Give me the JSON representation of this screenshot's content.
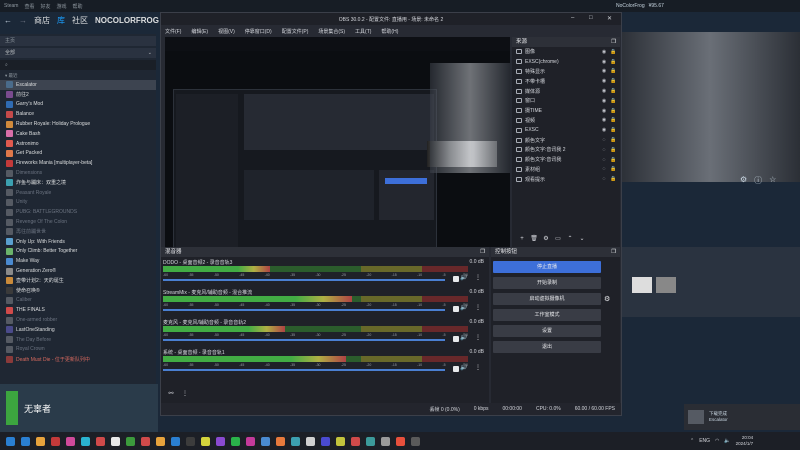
{
  "steam": {
    "title": "Steam",
    "menus": [
      "Steam",
      "查看",
      "好友",
      "游戏",
      "帮助"
    ],
    "nav": {
      "store": "商店",
      "library": "库",
      "community": "社区",
      "user": "NOCOLORFROG"
    },
    "user_bar": {
      "name": "NoColorFrog",
      "balance": "¥95.67"
    },
    "library": {
      "home": "主页",
      "filter": "全部",
      "section": "最近",
      "games": [
        {
          "name": "Escalator",
          "selected": true,
          "style": "normal",
          "color": "#4a6b8a"
        },
        {
          "name": "前往2",
          "style": "normal",
          "color": "#7a4b8f"
        },
        {
          "name": "Garry's Mod",
          "style": "normal",
          "color": "#2f6bb3"
        },
        {
          "name": "Balance",
          "style": "normal",
          "color": "#c44a4a"
        },
        {
          "name": "Rubber Royale: Holiday Prologue",
          "style": "normal",
          "color": "#d08a3c"
        },
        {
          "name": "Cake Bash",
          "style": "normal",
          "color": "#d86ea8"
        },
        {
          "name": "Astronimo",
          "style": "normal",
          "color": "#e05a4f"
        },
        {
          "name": "Get Packed",
          "style": "normal",
          "color": "#e0784a"
        },
        {
          "name": "Fireworks Mania [multiplayer-beta]",
          "style": "normal",
          "color": "#c33a3a"
        },
        {
          "name": "Dimensions",
          "style": "dim",
          "color": "#555a63"
        },
        {
          "name": "炸鱼与蹦床：双重之境",
          "style": "normal",
          "color": "#3ca0b0"
        },
        {
          "name": "Peasant Royale",
          "style": "dim",
          "color": "#555a63"
        },
        {
          "name": "Unity",
          "style": "dim",
          "color": "#555a63"
        },
        {
          "name": "PUBG: BATTLEGROUNDS",
          "style": "dim",
          "color": "#555a63"
        },
        {
          "name": "Revenge Of The Colon",
          "style": "dim",
          "color": "#555a63"
        },
        {
          "name": "再往前蹦世世",
          "style": "dim",
          "color": "#555a63"
        },
        {
          "name": "Only Up: With Friends",
          "style": "normal",
          "color": "#5aa0d0"
        },
        {
          "name": "Only Climb: Better Together",
          "style": "normal",
          "color": "#6bb36b"
        },
        {
          "name": "Make Way",
          "style": "normal",
          "color": "#4a8ad0"
        },
        {
          "name": "Generation Zero®",
          "style": "normal",
          "color": "#8a8a8a"
        },
        {
          "name": "壶带计划2：天的诞生",
          "style": "normal",
          "color": "#c98a3a"
        },
        {
          "name": "使命召唤®",
          "style": "normal",
          "color": "#3a3a3a"
        },
        {
          "name": "Caliber",
          "style": "dim",
          "color": "#555a63"
        },
        {
          "name": "THE FINALS",
          "style": "normal",
          "color": "#d04a4a"
        },
        {
          "name": "One-armed robber",
          "style": "dim",
          "color": "#555a63"
        },
        {
          "name": "LastOneStanding",
          "style": "normal",
          "color": "#4a4a8a"
        },
        {
          "name": "The Day Before",
          "style": "dim",
          "color": "#555a63"
        },
        {
          "name": "Royal Crown",
          "style": "dim",
          "color": "#555a63"
        },
        {
          "name": "Death Must Die - 位于更新队列中",
          "style": "red",
          "color": "#8a3a3a"
        }
      ]
    },
    "friends": {
      "name": "无辜者"
    }
  },
  "obs": {
    "title": "OBS 30.0.2 - 配置文件: 直播用 - 场景: 未命名 2",
    "menus": [
      "文件(F)",
      "编辑(E)",
      "视图(V)",
      "停靠窗口(D)",
      "配置文件(P)",
      "场景集合(S)",
      "工具(T)",
      "帮助(H)"
    ],
    "sources": {
      "header": "来源",
      "items": [
        {
          "name": "图像",
          "visible": true,
          "locked": true
        },
        {
          "name": "EXSC(chrome)",
          "visible": true,
          "locked": true
        },
        {
          "name": "特殊显示",
          "visible": true,
          "locked": true
        },
        {
          "name": "不带卡槽",
          "visible": true,
          "locked": true
        },
        {
          "name": "媒体源",
          "visible": true,
          "locked": true
        },
        {
          "name": "窗口",
          "visible": true,
          "locked": true
        },
        {
          "name": "摄TIME",
          "visible": true,
          "locked": true
        },
        {
          "name": "视频",
          "visible": true,
          "locked": true
        },
        {
          "name": "EXSC",
          "visible": true,
          "locked": true
        },
        {
          "name": "颜色文字",
          "visible": false,
          "locked": true
        },
        {
          "name": "颜色文字:音讯我 2",
          "visible": false,
          "locked": true
        },
        {
          "name": "颜色文字:音讯我",
          "visible": false,
          "locked": true
        },
        {
          "name": "素材组",
          "visible": false,
          "locked": true
        },
        {
          "name": "观看提示",
          "visible": false,
          "locked": true
        }
      ]
    },
    "mixer": {
      "header": "混音器",
      "ticks": [
        "-60",
        "-55",
        "-50",
        "-45",
        "-40",
        "-35",
        "-30",
        "-25",
        "-20",
        "-15",
        "-10",
        "-5",
        "0"
      ],
      "tracks": [
        {
          "label": "DODO - 桌面音频2 - 录音音轨3",
          "db": "0.0 dB",
          "level": 0.35
        },
        {
          "label": "StreamMix - 麦克风/辅助音频 - 混合推流",
          "db": "0.0 dB",
          "level": 0.62
        },
        {
          "label": "麦克风 - 麦克风/辅助音频 - 录音音轨2",
          "db": "0.0 dB",
          "level": 0.4
        },
        {
          "label": "系统 - 桌面音频 - 录音音轨1",
          "db": "0.0 dB",
          "level": 0.6
        }
      ]
    },
    "controls": {
      "header": "控制按钮",
      "stop_stream": "停止直播",
      "start_record": "开始录制",
      "virtual_cam": "启动虚拟摄像机",
      "studio_mode": "工作室模式",
      "settings": "设置",
      "exit": "退出"
    },
    "status": {
      "frames": "丢帧 0 (0.0%)",
      "net": "0 kbps",
      "time": "00:00:00",
      "cpu": "CPU: 0.0%",
      "fps": "60.00 / 60.00 FPS"
    }
  },
  "notification": {
    "title": "下载完成",
    "game": "Escalator"
  },
  "taskbar": {
    "icons": [
      "#2a7fd1",
      "#e8a33c",
      "#c43a3a",
      "#d04a9a",
      "#2ab3d0",
      "#d04a4a",
      "#e8e8e8",
      "#3c9a3c",
      "#d04a4a",
      "#e8a33c",
      "#2a7fd1",
      "#3c3c3c",
      "#d4d43c",
      "#8a4ad0",
      "#2ab34a",
      "#c43a9a",
      "#4a8ad0",
      "#e87a3c",
      "#3ca0b0",
      "#d0d0d0",
      "#4a4ad0",
      "#c4c43c",
      "#d04a4a",
      "#3c9a9a",
      "#9a9a9a",
      "#e8503c",
      "#5a5a5a"
    ],
    "lang": "ENG",
    "time": "20:04",
    "date": "2024/1/7"
  }
}
